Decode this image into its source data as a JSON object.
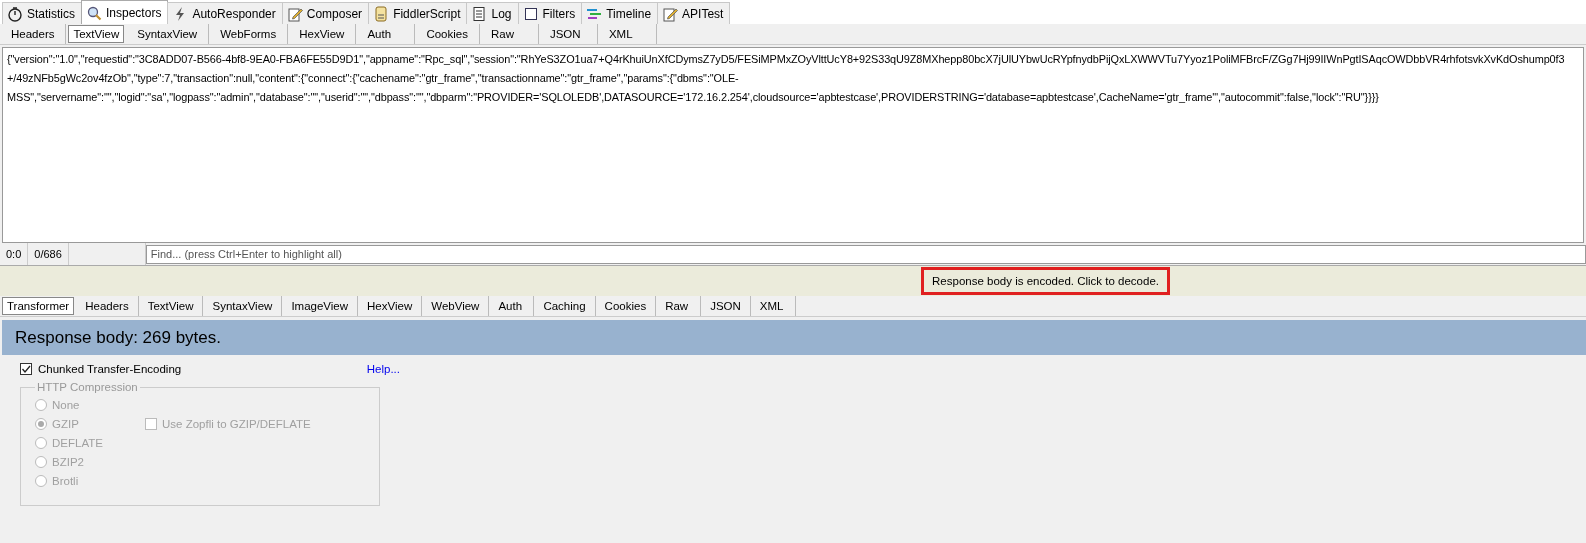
{
  "main_tabs": [
    {
      "label": "Statistics",
      "selected": false
    },
    {
      "label": "Inspectors",
      "selected": true
    },
    {
      "label": "AutoResponder",
      "selected": false
    },
    {
      "label": "Composer",
      "selected": false
    },
    {
      "label": "FiddlerScript",
      "selected": false
    },
    {
      "label": "Log",
      "selected": false
    },
    {
      "label": "Filters",
      "selected": false
    },
    {
      "label": "Timeline",
      "selected": false
    },
    {
      "label": "APITest",
      "selected": false
    }
  ],
  "request_tabs": [
    {
      "label": "Headers",
      "selected": false
    },
    {
      "label": "TextView",
      "selected": true
    },
    {
      "label": "SyntaxView",
      "selected": false
    },
    {
      "label": "WebForms",
      "selected": false
    },
    {
      "label": "HexView",
      "selected": false
    },
    {
      "label": "Auth",
      "selected": false
    },
    {
      "label": "Cookies",
      "selected": false
    },
    {
      "label": "Raw",
      "selected": false
    },
    {
      "label": "JSON",
      "selected": false
    },
    {
      "label": "XML",
      "selected": false
    }
  ],
  "request_body": [
    "{\"version\":\"1.0\",\"requestid\":\"3C8ADD07-B566-4bf8-9EA0-FBA6FE55D9D1\",\"appname\":\"Rpc_sql\",\"session\":\"RhYeS3ZO1ua7+Q4rKhuiUnXfCDymsZ7yD5/FESiMPMxZOyVlttUcY8+92S33qU9Z8MXhepp80bcX7jUlUYbwUcRYpfnydbPijQxLXWWVTu7Yyoz1PoliMFBrcF/ZGg7Hj99IIWnPgtISAqcOWDbbVR4rhfotsvkXvKdOshump0f3",
    "+/49zNFb5gWc2ov4fzOb\",\"type\":7,\"transaction\":null,\"content\":{\"connect\":{\"cachename\":\"gtr_frame\",\"transactionname\":\"gtr_frame\",\"params\":{\"dbms\":\"OLE-",
    "MSS\",\"servername\":\"\",\"logid\":\"sa\",\"logpass\":\"admin\",\"database\":\"\",\"userid\":\"\",\"dbpass\":\"\",\"dbparm\":\"PROVIDER='SQLOLEDB',DATASOURCE='172.16.2.254',cloudsource='apbtestcase',PROVIDERSTRING='database=apbtestcase',CacheName='gtr_frame'\",\"autocommit\":false,\"lock\":\"RU\"}}}}"
  ],
  "status": {
    "position": "0:0",
    "count": "0/686",
    "find_placeholder": "Find... (press Ctrl+Enter to highlight all)"
  },
  "notice": "Response body is encoded. Click to decode.",
  "response_tabs": [
    {
      "label": "Transformer",
      "selected": true
    },
    {
      "label": "Headers",
      "selected": false
    },
    {
      "label": "TextView",
      "selected": false
    },
    {
      "label": "SyntaxView",
      "selected": false
    },
    {
      "label": "ImageView",
      "selected": false
    },
    {
      "label": "HexView",
      "selected": false
    },
    {
      "label": "WebView",
      "selected": false
    },
    {
      "label": "Auth",
      "selected": false
    },
    {
      "label": "Caching",
      "selected": false
    },
    {
      "label": "Cookies",
      "selected": false
    },
    {
      "label": "Raw",
      "selected": false
    },
    {
      "label": "JSON",
      "selected": false
    },
    {
      "label": "XML",
      "selected": false
    }
  ],
  "response_header": "Response body: 269 bytes.",
  "chunked": {
    "label": "Chunked Transfer-Encoding",
    "checked": true
  },
  "help_link": "Help...",
  "compression": {
    "title": "HTTP Compression",
    "disabled": true,
    "options": [
      {
        "label": "None",
        "selected": false
      },
      {
        "label": "GZIP",
        "selected": true
      },
      {
        "label": "DEFLATE",
        "selected": false
      },
      {
        "label": "BZIP2",
        "selected": false
      },
      {
        "label": "Brotli",
        "selected": false
      }
    ],
    "zopfli": {
      "label": "Use Zopfli to GZIP/DEFLATE",
      "checked": false
    }
  }
}
